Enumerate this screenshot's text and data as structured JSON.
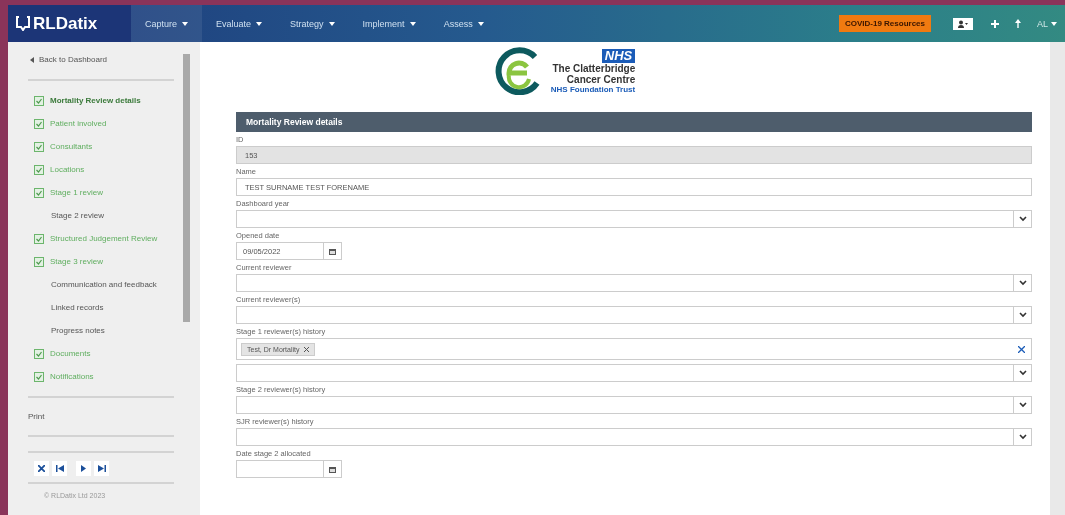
{
  "brand": {
    "name": "RLDatix"
  },
  "nav": [
    {
      "label": "Capture",
      "selected": true
    },
    {
      "label": "Evaluate",
      "selected": false
    },
    {
      "label": "Strategy",
      "selected": false
    },
    {
      "label": "Implement",
      "selected": false
    },
    {
      "label": "Assess",
      "selected": false
    }
  ],
  "header_actions": {
    "covid_button": "COVID-19 Resources",
    "user_menu": "AL"
  },
  "sidebar": {
    "back_link": "Back to Dashboard",
    "items": [
      {
        "label": "Mortality Review details",
        "done": true,
        "selected": true
      },
      {
        "label": "Patient involved",
        "done": true,
        "selected": false
      },
      {
        "label": "Consultants",
        "done": true,
        "selected": false
      },
      {
        "label": "Locations",
        "done": true,
        "selected": false
      },
      {
        "label": "Stage 1 review",
        "done": true,
        "selected": false
      },
      {
        "label": "Stage 2 review",
        "done": false,
        "selected": false
      },
      {
        "label": "Structured Judgement Review",
        "done": true,
        "selected": false
      },
      {
        "label": "Stage 3 review",
        "done": true,
        "selected": false
      },
      {
        "label": "Communication and feedback",
        "done": false,
        "selected": false
      },
      {
        "label": "Linked records",
        "done": false,
        "selected": false
      },
      {
        "label": "Progress notes",
        "done": false,
        "selected": false
      },
      {
        "label": "Documents",
        "done": true,
        "selected": false
      },
      {
        "label": "Notifications",
        "done": true,
        "selected": false
      }
    ],
    "print": "Print",
    "footer": "© RLDatix Ltd 2023"
  },
  "org_logo": {
    "badge": "NHS",
    "name_line_1": "The Clatterbridge",
    "name_line_2": "Cancer Centre",
    "trust": "NHS Foundation Trust"
  },
  "form": {
    "title": "Mortality Review details",
    "fields": [
      {
        "kind": "readonly",
        "label": "ID",
        "value": "153"
      },
      {
        "kind": "text",
        "label": "Name",
        "value": "TEST SURNAME TEST FORENAME"
      },
      {
        "kind": "select",
        "label": "Dashboard year"
      },
      {
        "kind": "date",
        "label": "Opened date",
        "value": "09/05/2022"
      },
      {
        "kind": "select",
        "label": "Current reviewer"
      },
      {
        "kind": "select",
        "label": "Current reviewer(s)"
      },
      {
        "kind": "tags",
        "label": "Stage 1 reviewer(s) history",
        "tags": [
          "Test, Dr Mortality"
        ]
      },
      {
        "kind": "select",
        "label": "Stage 2 reviewer(s) history"
      },
      {
        "kind": "select",
        "label": "SJR reviewer(s) history"
      },
      {
        "kind": "date",
        "label": "Date stage 2 allocated"
      }
    ]
  }
}
